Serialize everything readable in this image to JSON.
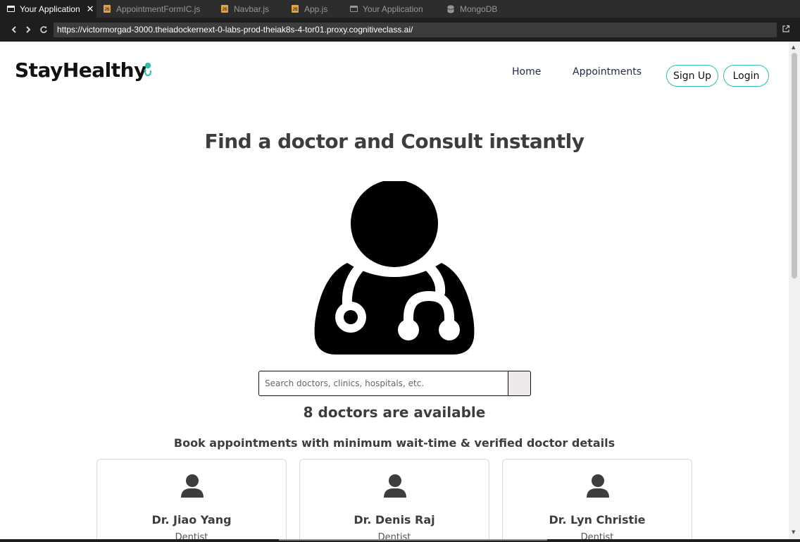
{
  "browser": {
    "tabs": [
      {
        "label": "Your Application",
        "icon": "window-icon",
        "active": true
      },
      {
        "label": "AppointmentFormIC.js",
        "icon": "js-file-icon",
        "active": false
      },
      {
        "label": "Navbar.js",
        "icon": "js-file-icon",
        "active": false
      },
      {
        "label": "App.js",
        "icon": "js-file-icon",
        "active": false
      },
      {
        "label": "Your Application",
        "icon": "window-icon",
        "active": false
      },
      {
        "label": "MongoDB",
        "icon": "database-icon",
        "active": false
      }
    ],
    "close_glyph": "✕",
    "url": "https://victormorgad-3000.theiadockernext-0-labs-prod-theiak8s-4-tor01.proxy.cognitiveclass.ai/"
  },
  "navbar": {
    "logo": "StayHealthy",
    "links": [
      "Home",
      "Appointments"
    ],
    "sign_up": "Sign Up",
    "login": "Login"
  },
  "hero": {
    "title": "Find a doctor and Consult instantly"
  },
  "search": {
    "placeholder": "Search doctors, clinics, hospitals, etc."
  },
  "availability": "8 doctors are available",
  "subtitle": "Book appointments with minimum wait-time & verified doctor details",
  "doctors": [
    {
      "name": "Dr. Jiao Yang",
      "speciality": "Dentist"
    },
    {
      "name": "Dr. Denis Raj",
      "speciality": "Dentist"
    },
    {
      "name": "Dr. Lyn Christie",
      "speciality": "Dentist"
    }
  ],
  "colors": {
    "accent": "#2fbfa7",
    "heading": "#3d3d3d",
    "browser_chrome": "#2d2d2d"
  }
}
